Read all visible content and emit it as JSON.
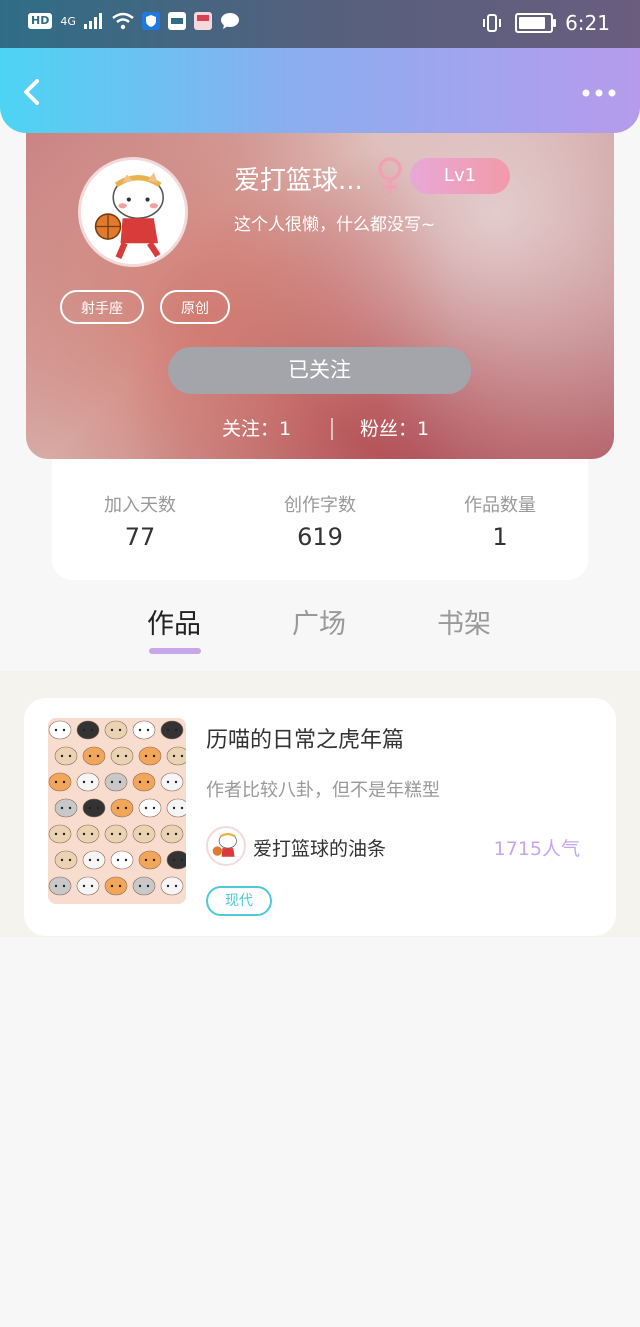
{
  "status_bar": {
    "hd_label": "HD",
    "network": "4G",
    "time": "6:21"
  },
  "nav": {
    "back_icon": "chevron-left-icon",
    "more_icon": "more-horizontal-icon"
  },
  "profile": {
    "name": "爱打篮球...",
    "gender_icon": "female-icon",
    "level": "Lv1",
    "bio": "这个人很懒，什么都没写~",
    "tags": [
      "射手座",
      "原创"
    ],
    "follow_button": "已关注",
    "following_text": "关注：1",
    "fans_text": "粉丝：1"
  },
  "stats": [
    {
      "label": "加入天数",
      "value": "77"
    },
    {
      "label": "创作字数",
      "value": "619"
    },
    {
      "label": "作品数量",
      "value": "1"
    }
  ],
  "tabs": [
    {
      "label": "作品",
      "active": true
    },
    {
      "label": "广场",
      "active": false
    },
    {
      "label": "书架",
      "active": false
    }
  ],
  "works": [
    {
      "title": "历喵的日常之虎年篇",
      "description": "作者比较八卦，但不是年糕型",
      "author": "爱打篮球的油条",
      "popularity": "1715人气",
      "genre": "现代"
    }
  ],
  "colors": {
    "accent_purple": "#c7a7ea",
    "genre_cyan": "#4dc9d8",
    "header_start": "#4dd4f3",
    "header_end": "#b69bec"
  }
}
